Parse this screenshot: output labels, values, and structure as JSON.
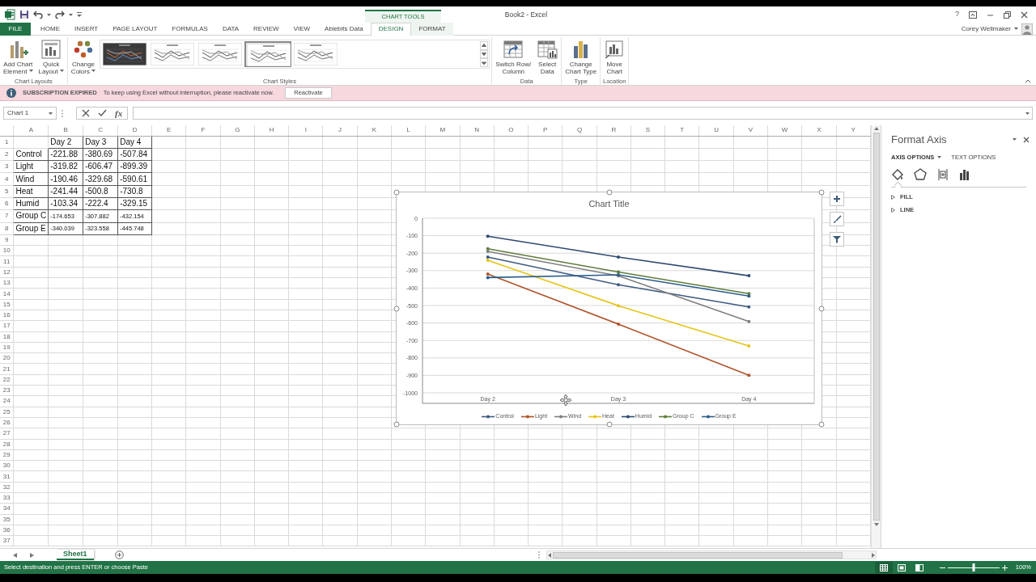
{
  "title_bar": {
    "title": "Book2 - Excel",
    "context_label": "CHART TOOLS",
    "help": "?",
    "user": "Corey Wellmaker"
  },
  "ribbon_tabs": [
    {
      "label": "FILE",
      "kind": "file",
      "selected": false
    },
    {
      "label": "HOME",
      "kind": "normal",
      "selected": false
    },
    {
      "label": "INSERT",
      "kind": "normal",
      "selected": false
    },
    {
      "label": "PAGE LAYOUT",
      "kind": "normal",
      "selected": false
    },
    {
      "label": "FORMULAS",
      "kind": "normal",
      "selected": false
    },
    {
      "label": "DATA",
      "kind": "normal",
      "selected": false
    },
    {
      "label": "REVIEW",
      "kind": "normal",
      "selected": false
    },
    {
      "label": "VIEW",
      "kind": "normal",
      "selected": false
    },
    {
      "label": "Ablebits Data",
      "kind": "normal",
      "selected": false
    },
    {
      "label": "DESIGN",
      "kind": "context",
      "selected": true
    },
    {
      "label": "FORMAT",
      "kind": "context",
      "selected": false
    }
  ],
  "ribbon_groups": [
    {
      "label": "Chart Layouts",
      "buttons": [
        {
          "kind": "element",
          "lines": [
            "Add Chart",
            "Element"
          ],
          "dropdown": true
        },
        {
          "kind": "layout",
          "lines": [
            "Quick",
            "Layout"
          ],
          "dropdown": true
        }
      ]
    },
    {
      "label": "Chart Styles",
      "buttons": [
        {
          "kind": "colors",
          "lines": [
            "Change",
            "Colors"
          ],
          "dropdown": true
        }
      ],
      "gallery": [
        {
          "kind": "dark",
          "selected": false
        },
        {
          "kind": "light",
          "selected": false
        },
        {
          "kind": "light",
          "selected": false
        },
        {
          "kind": "light",
          "selected": true
        },
        {
          "kind": "light",
          "selected": false
        }
      ]
    },
    {
      "label": "Data",
      "buttons": [
        {
          "kind": "switch",
          "lines": [
            "Switch Row/",
            "Column"
          ],
          "dropdown": false
        },
        {
          "kind": "select",
          "lines": [
            "Select",
            "Data"
          ],
          "dropdown": false
        }
      ]
    },
    {
      "label": "Type",
      "buttons": [
        {
          "kind": "type",
          "lines": [
            "Change",
            "Chart Type"
          ],
          "dropdown": false
        }
      ]
    },
    {
      "label": "Location",
      "buttons": [
        {
          "kind": "move",
          "lines": [
            "Move",
            "Chart"
          ],
          "dropdown": false
        }
      ]
    }
  ],
  "message_bar": {
    "title": "SUBSCRIPTION EXPIRED",
    "text": "To keep using Excel without interruption, please reactivate now.",
    "button": "Reactivate"
  },
  "formula_bar": {
    "name_box": "Chart 1",
    "function_button": "fx"
  },
  "sheet": {
    "columns": [
      "A",
      "B",
      "C",
      "D",
      "E",
      "F",
      "G",
      "H",
      "I",
      "J",
      "K",
      "L",
      "M",
      "N",
      "O",
      "P",
      "Q",
      "R",
      "S",
      "T",
      "U",
      "V",
      "W",
      "X",
      "Y"
    ],
    "rows": [
      "1",
      "2",
      "3",
      "4",
      "5",
      "6",
      "7",
      "8",
      "9",
      "10",
      "11",
      "12",
      "13",
      "14",
      "15",
      "16",
      "17",
      "18",
      "19",
      "20",
      "21",
      "22",
      "23",
      "24",
      "25",
      "26",
      "27",
      "28",
      "29",
      "30",
      "31",
      "32",
      "33",
      "34",
      "35",
      "36",
      "37"
    ],
    "cells": [
      {
        "values": [
          "Day 2",
          "Day 3",
          "Day 4"
        ],
        "compact": false
      },
      {
        "label": "Control",
        "values": [
          "-221.88",
          "-380.69",
          "-507.84"
        ],
        "compact": false
      },
      {
        "label": "Light",
        "values": [
          "-319.82",
          "-606.47",
          "-899.39"
        ],
        "compact": false
      },
      {
        "label": "Wind",
        "values": [
          "-190.46",
          "-329.68",
          "-590.61"
        ],
        "compact": false
      },
      {
        "label": "Heat",
        "values": [
          "-241.44",
          "-500.8",
          "-730.8"
        ],
        "compact": false
      },
      {
        "label": "Humid",
        "values": [
          "-103.34",
          "-222.4",
          "-329.15"
        ],
        "compact": false
      },
      {
        "label": "Group C",
        "values": [
          "-174.653",
          "-307.882",
          "-432.154"
        ],
        "compact": true
      },
      {
        "label": "Group E",
        "values": [
          "-340.039",
          "-323.558",
          "-445.748"
        ],
        "compact": true
      }
    ]
  },
  "chart": {
    "chart_data": {
      "type": "line",
      "title": "Chart Title",
      "grid": true,
      "legend": "bottom",
      "categories": [
        "Day 2",
        "Day 3",
        "Day 4"
      ],
      "ylim": [
        -1000,
        0
      ],
      "yticks": [
        0,
        -100,
        -200,
        -300,
        -400,
        -500,
        -600,
        -700,
        -800,
        -900,
        -1000
      ],
      "series": [
        {
          "name": "Control",
          "color": "#3c5a82",
          "values": [
            -222,
            -381,
            -508
          ]
        },
        {
          "name": "Light",
          "color": "#b0552b",
          "values": [
            -320,
            -606,
            -899
          ]
        },
        {
          "name": "Wind",
          "color": "#7f7f7f",
          "values": [
            -190,
            -330,
            -591
          ]
        },
        {
          "name": "Heat",
          "color": "#e6c417",
          "values": [
            -241,
            -501,
            -731
          ]
        },
        {
          "name": "Humid",
          "color": "#2f4a70",
          "values": [
            -103,
            -222,
            -329
          ]
        },
        {
          "name": "Group C",
          "color": "#5e7d3c",
          "values": [
            -175,
            -308,
            -432
          ]
        },
        {
          "name": "Group E",
          "color": "#2c5d8a",
          "values": [
            -340,
            -324,
            -446
          ]
        }
      ]
    }
  },
  "format_pane": {
    "title": "Format Axis",
    "tabs": [
      {
        "label": "AXIS OPTIONS",
        "selected": true
      },
      {
        "label": "TEXT OPTIONS",
        "selected": false
      }
    ],
    "icon_tabs": [
      {
        "kind": "fill",
        "selected": true
      },
      {
        "kind": "effects",
        "selected": false
      },
      {
        "kind": "size",
        "selected": false
      },
      {
        "kind": "axis",
        "selected": false
      }
    ],
    "sections": [
      {
        "label": "FILL",
        "expanded": false
      },
      {
        "label": "LINE",
        "expanded": false
      }
    ]
  },
  "sheet_tabs": [
    {
      "label": "Sheet1",
      "selected": true
    }
  ],
  "status_bar": {
    "text": "Select destination and press ENTER or choose Paste",
    "views": [
      {
        "kind": "normal",
        "selected": true
      },
      {
        "kind": "layout",
        "selected": false
      },
      {
        "kind": "preview",
        "selected": false
      }
    ],
    "zoom": {
      "level": 0.5,
      "reading": "100%"
    }
  }
}
